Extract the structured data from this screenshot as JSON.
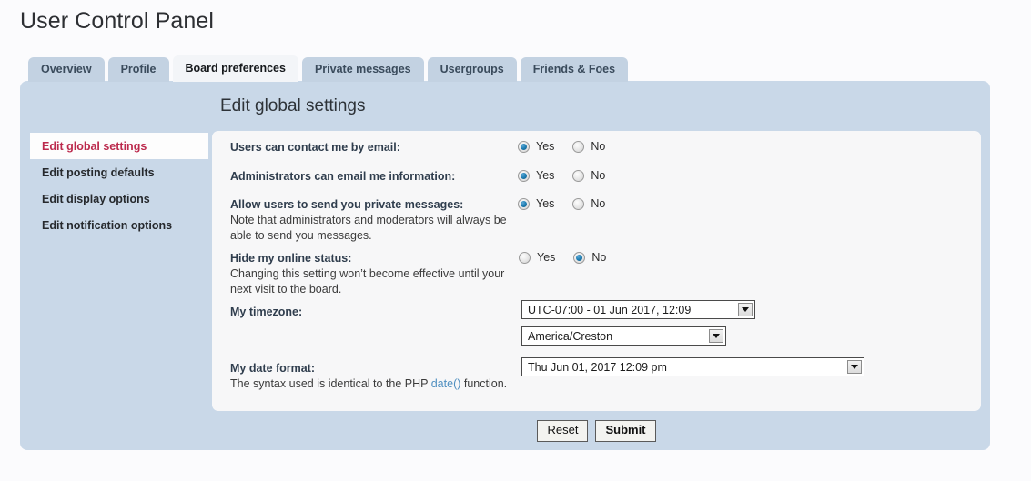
{
  "page": {
    "title": "User Control Panel"
  },
  "tabs": [
    {
      "label": "Overview",
      "active": false
    },
    {
      "label": "Profile",
      "active": false
    },
    {
      "label": "Board preferences",
      "active": true
    },
    {
      "label": "Private messages",
      "active": false
    },
    {
      "label": "Usergroups",
      "active": false
    },
    {
      "label": "Friends & Foes",
      "active": false
    }
  ],
  "sidebar": {
    "items": [
      {
        "label": "Edit global settings",
        "active": true
      },
      {
        "label": "Edit posting defaults",
        "active": false
      },
      {
        "label": "Edit display options",
        "active": false
      },
      {
        "label": "Edit notification options",
        "active": false
      }
    ]
  },
  "main": {
    "heading": "Edit global settings",
    "radio_yes_label": "Yes",
    "radio_no_label": "No",
    "rows": [
      {
        "title": "Users can contact me by email:",
        "desc": "",
        "selected": "yes"
      },
      {
        "title": "Administrators can email me information:",
        "desc": "",
        "selected": "yes"
      },
      {
        "title": "Allow users to send you private messages:",
        "desc": "Note that administrators and moderators will always be able to send you messages.",
        "selected": "yes"
      },
      {
        "title": "Hide my online status:",
        "desc": "Changing this setting won’t become effective until your next visit to the board.",
        "selected": "no"
      }
    ],
    "timezone": {
      "title": "My timezone:",
      "offset_value": "UTC-07:00 - 01 Jun 2017, 12:09",
      "region_value": "America/Creston"
    },
    "dateformat": {
      "title": "My date format:",
      "desc_before": "The syntax used is identical to the PHP ",
      "desc_link": "date()",
      "desc_after": " function.",
      "value": "Thu Jun 01, 2017 12:09 pm"
    }
  },
  "buttons": {
    "reset": "Reset",
    "submit": "Submit"
  },
  "colors": {
    "panel": "#c9d8e8",
    "card": "#f7f7f8",
    "tab_inactive": "#c3d2e2",
    "tab_active": "#f3f5f8",
    "accent_active_link": "#bc2a4d",
    "link": "#4f8fc0",
    "radio_dot": "#1f7fb5"
  }
}
